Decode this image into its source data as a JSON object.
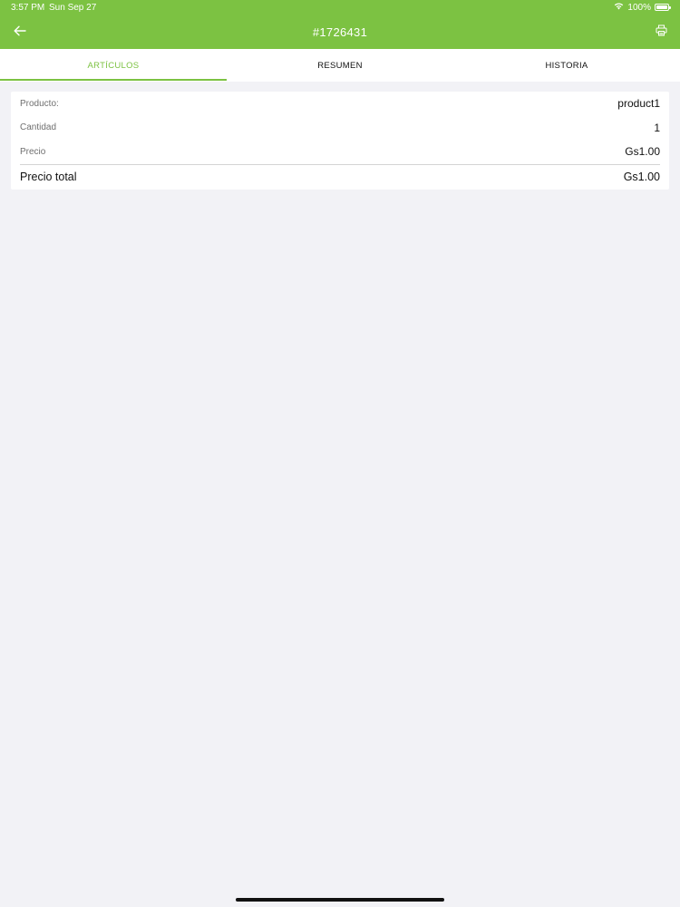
{
  "status_bar": {
    "time": "3:57 PM",
    "date": "Sun Sep 27",
    "battery": "100%",
    "battery_level": 1.0
  },
  "navbar": {
    "title": "#1726431",
    "back_icon": "arrow-left-icon",
    "print_icon": "printer-icon"
  },
  "tabs": [
    {
      "label": "ARTÍCULOS",
      "active": true
    },
    {
      "label": "RESUMEN",
      "active": false
    },
    {
      "label": "HISTORIA",
      "active": false
    }
  ],
  "item": {
    "rows": [
      {
        "label": "Producto:",
        "value": "product1"
      },
      {
        "label": "Cantidad",
        "value": "1"
      },
      {
        "label": "Precio",
        "value": "Gs1.00"
      }
    ],
    "total": {
      "label": "Precio total",
      "value": "Gs1.00"
    }
  },
  "colors": {
    "accent": "#7cc242",
    "background": "#f2f2f6",
    "card": "#ffffff"
  }
}
